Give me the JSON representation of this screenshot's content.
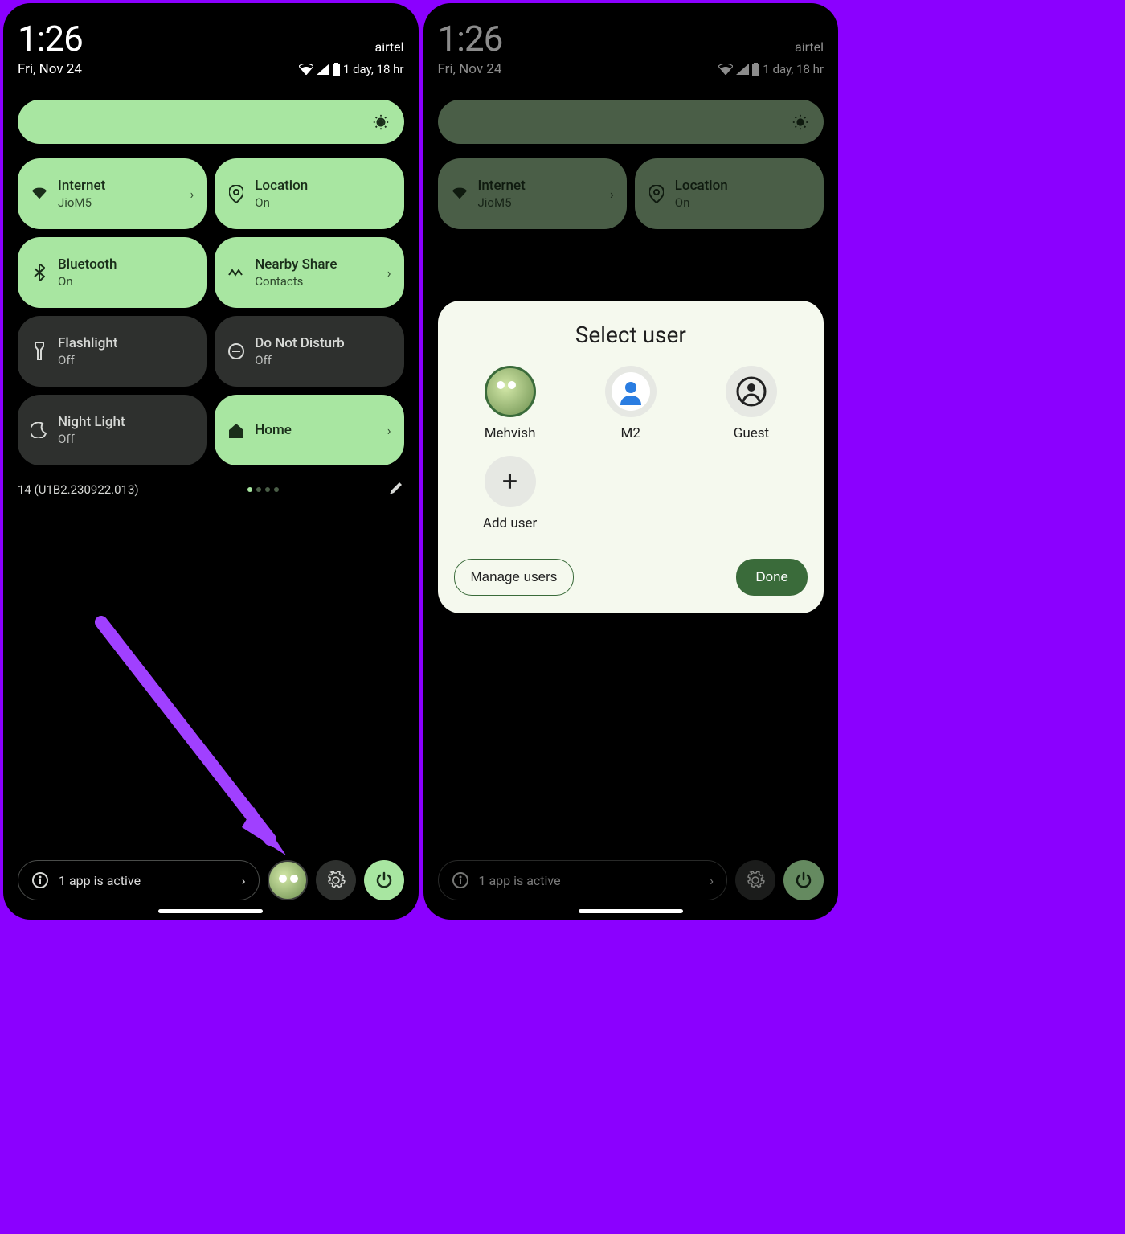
{
  "status": {
    "time": "1:26",
    "date": "Fri, Nov 24",
    "carrier": "airtel",
    "battery_text": "1 day, 18 hr"
  },
  "tiles": {
    "internet": {
      "title": "Internet",
      "sub": "JioM5"
    },
    "location": {
      "title": "Location",
      "sub": "On"
    },
    "bluetooth": {
      "title": "Bluetooth",
      "sub": "On"
    },
    "nearby": {
      "title": "Nearby Share",
      "sub": "Contacts"
    },
    "flashlight": {
      "title": "Flashlight",
      "sub": "Off"
    },
    "dnd": {
      "title": "Do Not Disturb",
      "sub": "Off"
    },
    "nightlight": {
      "title": "Night Light",
      "sub": "Off"
    },
    "home": {
      "title": "Home",
      "sub": ""
    }
  },
  "build": "14 (U1B2.230922.013)",
  "active_apps": "1 app is active",
  "dialog": {
    "title": "Select user",
    "users": {
      "u1": "Mehvish",
      "u2": "M2",
      "guest": "Guest",
      "add": "Add user"
    },
    "manage": "Manage users",
    "done": "Done"
  }
}
